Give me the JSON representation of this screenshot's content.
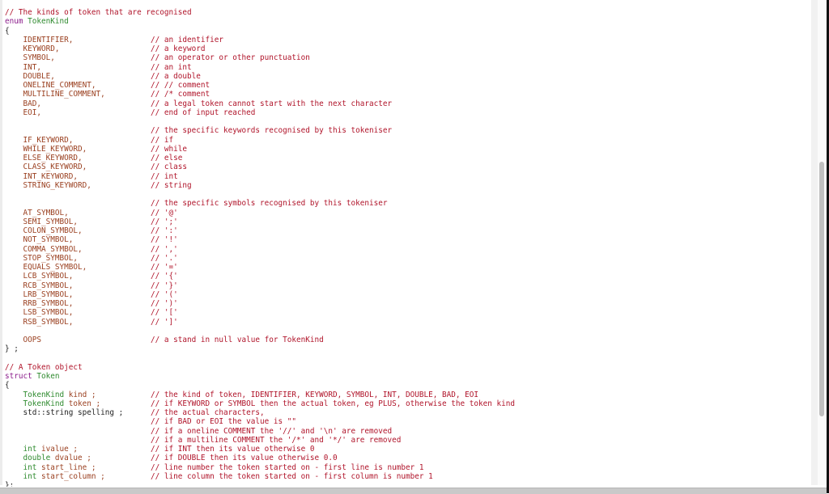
{
  "editor": {
    "language": "C++",
    "colors": {
      "comment": "#b0142a",
      "keyword": "#8b1c8b",
      "type": "#2e8a2e",
      "member": "#9a3f1f",
      "plain": "#222222",
      "scroll_thumb": "#bfbfbf"
    },
    "lines": [
      {
        "segments": [
          {
            "t": "// The kinds of token that are recognised",
            "c": "comment"
          }
        ]
      },
      {
        "segments": [
          {
            "t": "enum ",
            "c": "kw"
          },
          {
            "t": "TokenKind",
            "c": "type"
          }
        ]
      },
      {
        "segments": [
          {
            "t": "{",
            "c": "plain"
          }
        ]
      },
      {
        "segments": [
          {
            "t": "    IDENTIFIER,",
            "c": "member"
          }
        ],
        "comment": "// an identifier"
      },
      {
        "segments": [
          {
            "t": "    KEYWORD,",
            "c": "member"
          }
        ],
        "comment": "// a keyword"
      },
      {
        "segments": [
          {
            "t": "    SYMBOL,",
            "c": "member"
          }
        ],
        "comment": "// an operator or other punctuation"
      },
      {
        "segments": [
          {
            "t": "    INT,",
            "c": "member"
          }
        ],
        "comment": "// an int"
      },
      {
        "segments": [
          {
            "t": "    DOUBLE,",
            "c": "member"
          }
        ],
        "comment": "// a double"
      },
      {
        "segments": [
          {
            "t": "    ONELINE_COMMENT,",
            "c": "member"
          }
        ],
        "comment": "// // comment"
      },
      {
        "segments": [
          {
            "t": "    MULTILINE_COMMENT,",
            "c": "member"
          }
        ],
        "comment": "// /* comment"
      },
      {
        "segments": [
          {
            "t": "    BAD,",
            "c": "member"
          }
        ],
        "comment": "// a legal token cannot start with the next character"
      },
      {
        "segments": [
          {
            "t": "    EOI,",
            "c": "member"
          }
        ],
        "comment": "// end of input reached"
      },
      {
        "segments": []
      },
      {
        "segments": [],
        "comment": "// the specific keywords recognised by this tokeniser"
      },
      {
        "segments": [
          {
            "t": "    IF_KEYWORD,",
            "c": "member"
          }
        ],
        "comment": "// if"
      },
      {
        "segments": [
          {
            "t": "    WHILE_KEYWORD,",
            "c": "member"
          }
        ],
        "comment": "// while"
      },
      {
        "segments": [
          {
            "t": "    ELSE_KEYWORD,",
            "c": "member"
          }
        ],
        "comment": "// else"
      },
      {
        "segments": [
          {
            "t": "    CLASS_KEYWORD,",
            "c": "member"
          }
        ],
        "comment": "// class"
      },
      {
        "segments": [
          {
            "t": "    INT_KEYWORD,",
            "c": "member"
          }
        ],
        "comment": "// int"
      },
      {
        "segments": [
          {
            "t": "    STRING_KEYWORD,",
            "c": "member"
          }
        ],
        "comment": "// string"
      },
      {
        "segments": []
      },
      {
        "segments": [],
        "comment": "// the specific symbols recognised by this tokeniser"
      },
      {
        "segments": [
          {
            "t": "    AT_SYMBOL,",
            "c": "member"
          }
        ],
        "comment": "// '@'"
      },
      {
        "segments": [
          {
            "t": "    SEMI_SYMBOL,",
            "c": "member"
          }
        ],
        "comment": "// ';'"
      },
      {
        "segments": [
          {
            "t": "    COLON_SYMBOL,",
            "c": "member"
          }
        ],
        "comment": "// ':'"
      },
      {
        "segments": [
          {
            "t": "    NOT_SYMBOL,",
            "c": "member"
          }
        ],
        "comment": "// '!'"
      },
      {
        "segments": [
          {
            "t": "    COMMA_SYMBOL,",
            "c": "member"
          }
        ],
        "comment": "// ','"
      },
      {
        "segments": [
          {
            "t": "    STOP_SYMBOL,",
            "c": "member"
          }
        ],
        "comment": "// '.'"
      },
      {
        "segments": [
          {
            "t": "    EQUALS_SYMBOL,",
            "c": "member"
          }
        ],
        "comment": "// '='"
      },
      {
        "segments": [
          {
            "t": "    LCB_SYMBOL,",
            "c": "member"
          }
        ],
        "comment": "// '{'"
      },
      {
        "segments": [
          {
            "t": "    RCB_SYMBOL,",
            "c": "member"
          }
        ],
        "comment": "// '}'"
      },
      {
        "segments": [
          {
            "t": "    LRB_SYMBOL,",
            "c": "member"
          }
        ],
        "comment": "// '('"
      },
      {
        "segments": [
          {
            "t": "    RRB_SYMBOL,",
            "c": "member"
          }
        ],
        "comment": "// ')'"
      },
      {
        "segments": [
          {
            "t": "    LSB_SYMBOL,",
            "c": "member"
          }
        ],
        "comment": "// '['"
      },
      {
        "segments": [
          {
            "t": "    RSB_SYMBOL,",
            "c": "member"
          }
        ],
        "comment": "// ']'"
      },
      {
        "segments": []
      },
      {
        "segments": [
          {
            "t": "    OOPS",
            "c": "member"
          }
        ],
        "comment": "// a stand in null value for TokenKind"
      },
      {
        "segments": [
          {
            "t": "} ;",
            "c": "plain"
          }
        ]
      },
      {
        "segments": []
      },
      {
        "segments": [
          {
            "t": "// A Token object",
            "c": "comment"
          }
        ]
      },
      {
        "segments": [
          {
            "t": "struct ",
            "c": "kw"
          },
          {
            "t": "Token",
            "c": "type"
          }
        ]
      },
      {
        "segments": [
          {
            "t": "{",
            "c": "plain"
          }
        ]
      },
      {
        "segments": [
          {
            "t": "    ",
            "c": "plain"
          },
          {
            "t": "TokenKind",
            "c": "type"
          },
          {
            "t": " kind ;",
            "c": "member"
          }
        ],
        "comment": "// the kind of token, IDENTIFIER, KEYWORD, SYMBOL, INT, DOUBLE, BAD, EOI"
      },
      {
        "segments": [
          {
            "t": "    ",
            "c": "plain"
          },
          {
            "t": "TokenKind",
            "c": "type"
          },
          {
            "t": " token ;",
            "c": "member"
          }
        ],
        "comment": "// if KEYWORD or SYMBOL then the actual token, eg PLUS, otherwise the token kind"
      },
      {
        "segments": [
          {
            "t": "    std::string spelling ;",
            "c": "plain"
          }
        ],
        "comment": "// the actual characters,"
      },
      {
        "segments": [],
        "comment": "// if BAD or EOI the value is \"\""
      },
      {
        "segments": [],
        "comment": "// if a oneline COMMENT the '//' and '\\n' are removed"
      },
      {
        "segments": [],
        "comment": "// if a multiline COMMENT the '/*' and '*/' are removed"
      },
      {
        "segments": [
          {
            "t": "    ",
            "c": "plain"
          },
          {
            "t": "int",
            "c": "type"
          },
          {
            "t": " ivalue ;",
            "c": "member"
          }
        ],
        "comment": "// if INT then its value otherwise 0"
      },
      {
        "segments": [
          {
            "t": "    ",
            "c": "plain"
          },
          {
            "t": "double",
            "c": "type"
          },
          {
            "t": " dvalue ;",
            "c": "member"
          }
        ],
        "comment": "// if DOUBLE then its value otherwise 0.0"
      },
      {
        "segments": [
          {
            "t": "    ",
            "c": "plain"
          },
          {
            "t": "int",
            "c": "type"
          },
          {
            "t": " start_line ;",
            "c": "member"
          }
        ],
        "comment": "// line number the token started on - first line is number 1"
      },
      {
        "segments": [
          {
            "t": "    ",
            "c": "plain"
          },
          {
            "t": "int",
            "c": "type"
          },
          {
            "t": " start_column ;",
            "c": "member"
          }
        ],
        "comment": "// line column the token started on - first column is number 1"
      },
      {
        "segments": [
          {
            "t": "};",
            "c": "plain"
          }
        ]
      }
    ]
  },
  "scrollbar": {
    "vertical_position_fraction": 0.33,
    "visible_fraction": 0.52
  }
}
